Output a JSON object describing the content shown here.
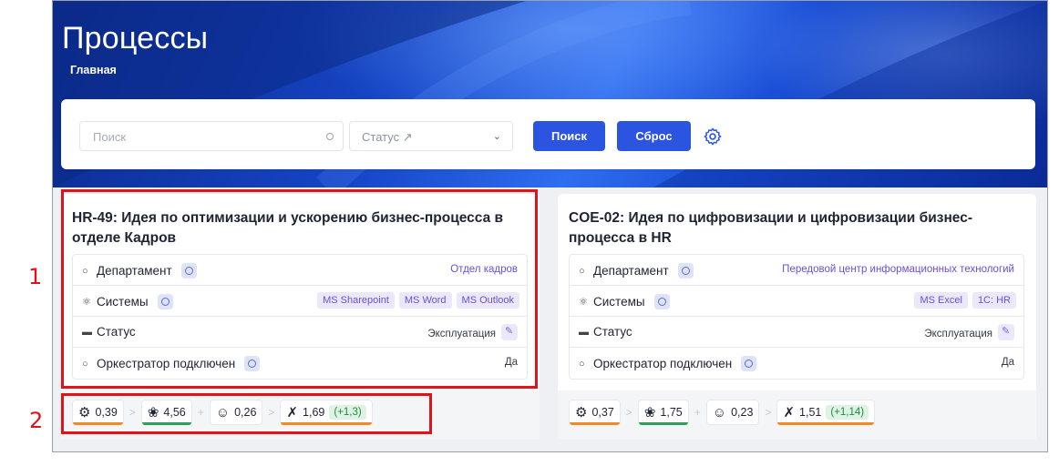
{
  "header": {
    "title": "Процессы",
    "breadcrumb": "Главная"
  },
  "filters": {
    "search_placeholder": "Поиск",
    "status_placeholder": "Статус ↗",
    "search_button": "Поиск",
    "reset_button": "Сброс",
    "settings_icon": "gear-icon"
  },
  "labels": {
    "department": "Департамент",
    "systems": "Системы",
    "status": "Статус",
    "orchestrator": "Оркестратор подключен"
  },
  "cards": [
    {
      "title": "HR-49: Идея по оптимизации и ускорению бизнес-процесса в отделе Кадров",
      "department": "Отдел кадров",
      "systems": [
        "MS Sharepoint",
        "MS Word",
        "MS Outlook"
      ],
      "status": "Эксплуатация",
      "orchestrator": "Да",
      "metrics": {
        "m1": "0,39",
        "m2": "4,56",
        "m3": "0,26",
        "m4": "1,69",
        "delta": "(+1,3)"
      }
    },
    {
      "title": "COE-02: Идея по цифровизации и цифровизации бизнес-процесса в HR",
      "department": "Передовой центр информационных технологий",
      "systems": [
        "MS Excel",
        "1C: HR"
      ],
      "status": "Эксплуатация",
      "orchestrator": "Да",
      "metrics": {
        "m1": "0,37",
        "m2": "1,75",
        "m3": "0,23",
        "m4": "1,51",
        "delta": "(+1,14)"
      }
    }
  ],
  "annotations": {
    "marker_1": "1",
    "marker_2": "2"
  },
  "colors": {
    "accent": "#2b55e0",
    "tag": "#6a4ee0",
    "bar_orange": "#f08a24",
    "bar_green": "#2f9e5b",
    "highlight": "#e0131b"
  }
}
